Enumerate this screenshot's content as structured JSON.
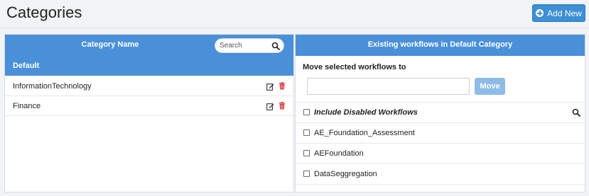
{
  "header": {
    "title": "Categories",
    "add_new_label": "Add New",
    "accent": "#3d8fd6"
  },
  "left_panel": {
    "column_title": "Category Name",
    "search_placeholder": "Search",
    "categories": [
      {
        "label": "Default",
        "selected": true
      },
      {
        "label": "InformationTechnology",
        "selected": false
      },
      {
        "label": "Finance",
        "selected": false
      }
    ],
    "icons": {
      "edit": "edit-icon",
      "delete": "trash-icon",
      "search": "search-icon"
    },
    "colors": {
      "header": "#4a90d9",
      "delete": "#d9363e"
    }
  },
  "right_panel": {
    "title": "Existing workflows in Default Category",
    "move_label": "Move selected workflows to",
    "move_input_value": "",
    "move_button_label": "Move",
    "include_disabled_label": "Include Disabled Workflows",
    "workflows": [
      {
        "label": "AE_Foundation_Assessment",
        "checked": false
      },
      {
        "label": "AEFoundation",
        "checked": false
      },
      {
        "label": "DataSeggregation",
        "checked": false
      }
    ]
  }
}
